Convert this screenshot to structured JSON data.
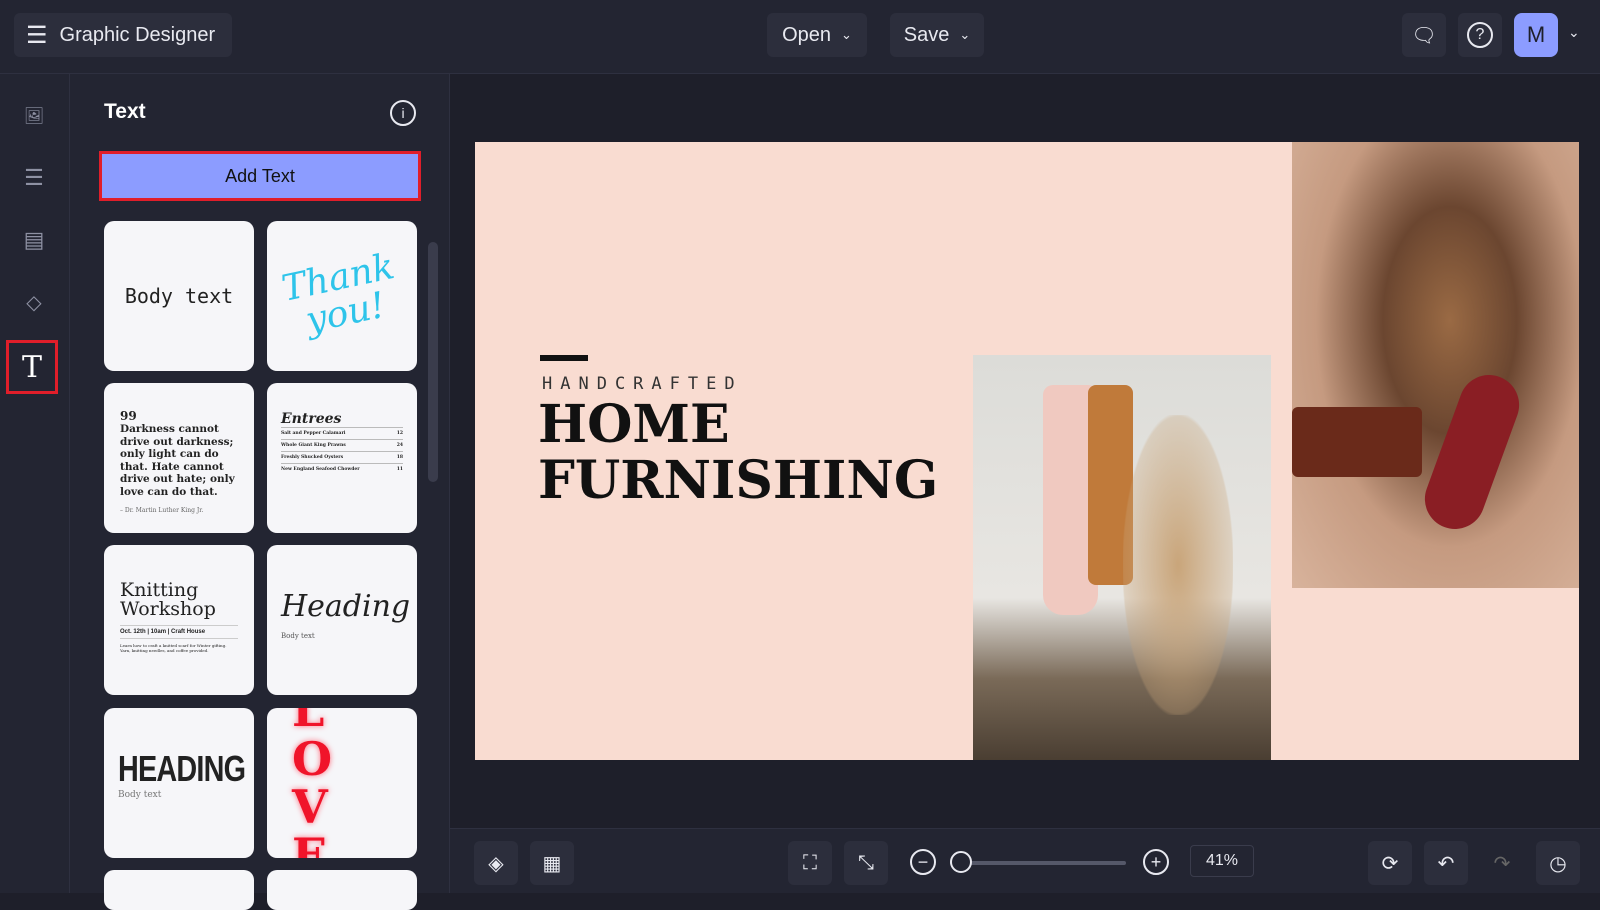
{
  "header": {
    "app_title": "Graphic Designer",
    "open_label": "Open",
    "save_label": "Save",
    "avatar_initial": "M"
  },
  "panel": {
    "title": "Text",
    "add_text_label": "Add Text",
    "templates": {
      "body_text": "Body text",
      "thank_you": "Thank you!",
      "quote_mark": "99",
      "quote": "Darkness cannot drive out darkness; only light can do that. Hate cannot drive out hate; only love can do that.",
      "quote_author": "– Dr. Martin Luther King Jr.",
      "menu_title": "Entrees",
      "menu_items": [
        {
          "name": "Salt and Pepper Calamari",
          "price": "12"
        },
        {
          "name": "Whole Giant King Prawns",
          "price": "24"
        },
        {
          "name": "Freshly Shucked Oysters",
          "price": "18"
        },
        {
          "name": "New England Seafood Chowder",
          "price": "11"
        }
      ],
      "knitting_title": "Knitting Workshop",
      "knitting_details": "Oct. 12th | 10am | Craft House",
      "knitting_desc": "Learn how to craft a knitted scarf for Winter gifting. Yarn, knitting needles, and coffee provided.",
      "script_heading": "Heading",
      "script_body": "Body text",
      "bold_heading": "HEADING",
      "bold_body": "Body text",
      "love": "LOVE"
    }
  },
  "canvas": {
    "eyebrow": "HANDCRAFTED",
    "title_line1": "HOME",
    "title_line2": "FURNISHING",
    "bg_color": "#f9dcd1"
  },
  "bottom": {
    "zoom_percent": "41%",
    "zoom_value": 41
  }
}
